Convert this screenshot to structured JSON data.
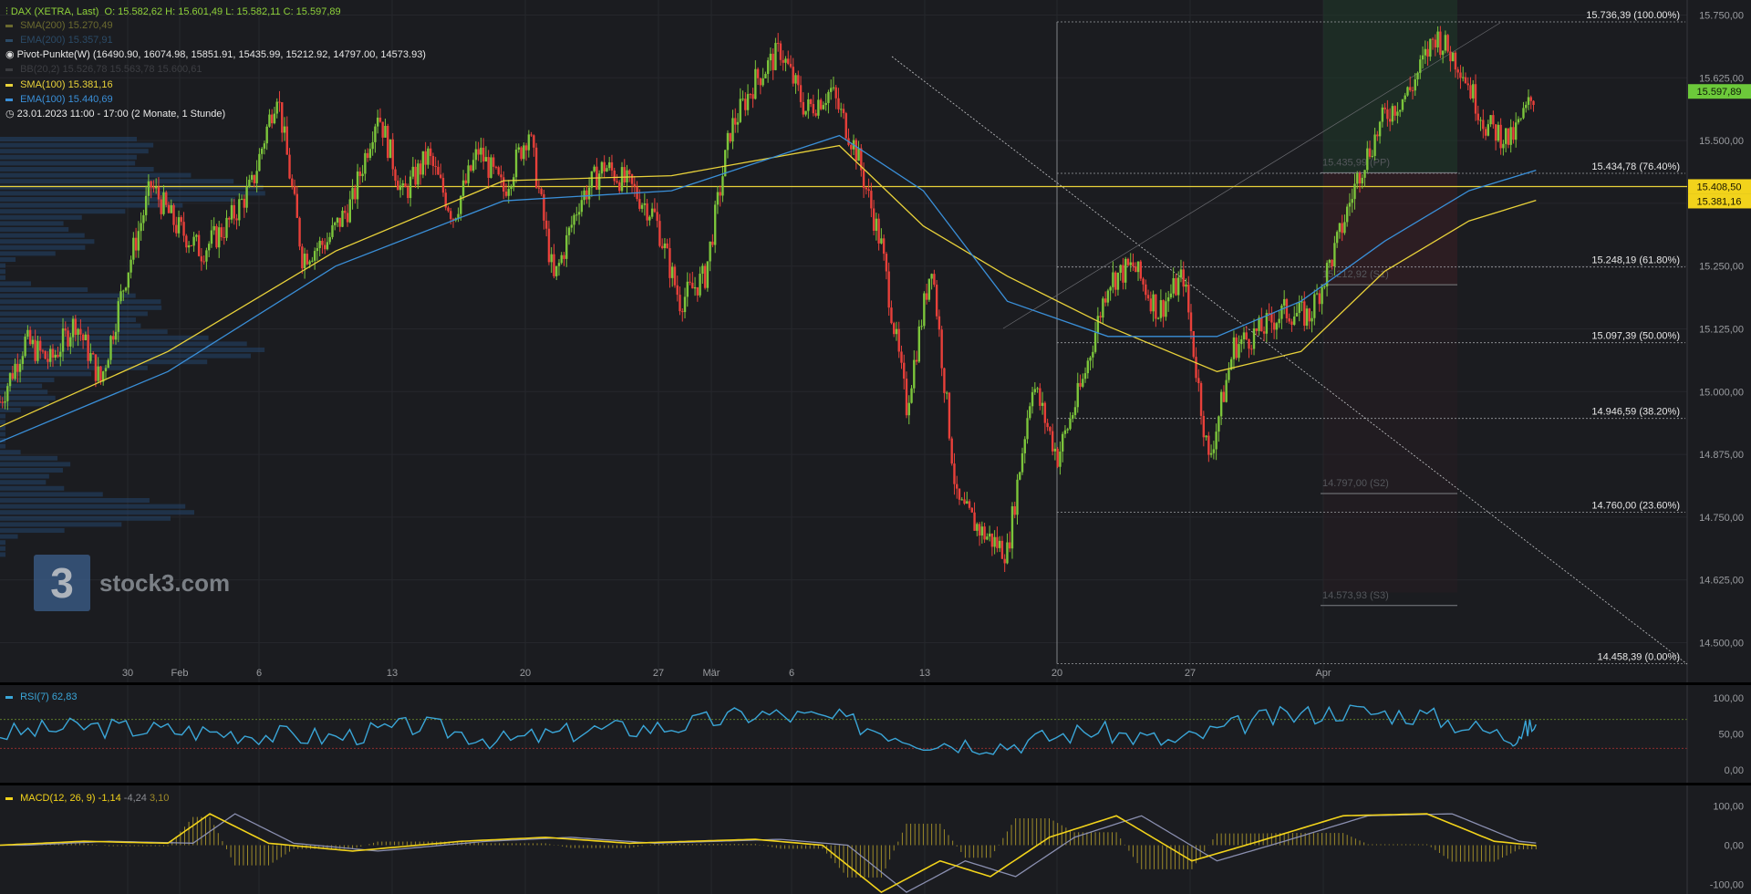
{
  "header": {
    "symbol": "DAX (XETRA, Last)",
    "ohlc": "O: 15.582,62  H: 15.601,49  L: 15.582,11  C: 15.597,89",
    "sma200": {
      "label": "SMA(200)",
      "value": "15.270,49",
      "color": "#6b6a2f"
    },
    "ema200": {
      "label": "EMA(200)",
      "value": "15.357,91",
      "color": "#2b4a66"
    },
    "pivot": {
      "label": "Pivot-Punkte(W)",
      "value": "(16490.90,  16074.98,  15851.91,  15435.99,  15212.92,  14797.00,  14573.93)"
    },
    "bb": {
      "label": "BB(20,2)",
      "value": "15.526,78  15.563,78  15.600,61"
    },
    "sma100": {
      "label": "SMA(100)",
      "value": "15.381,16",
      "color": "#e9d23a"
    },
    "ema100": {
      "label": "EMA(100)",
      "value": "15.440,69",
      "color": "#3a8fd8"
    },
    "range": "23.01.2023 11:00 - 17:00   (2 Monate, 1 Stunde)"
  },
  "logo": {
    "mark": "3",
    "text": "stock3.com"
  },
  "price_axis": {
    "ticks": [
      "15.750,00",
      "15.625,00",
      "15.500,00",
      "15.375,00",
      "15.250,00",
      "15.125,00",
      "15.000,00",
      "14.875,00",
      "14.750,00",
      "14.625,00",
      "14.500,00"
    ],
    "last_price": "15.597,89",
    "level_a": "15.408,50",
    "level_b": "15.381,16"
  },
  "fib_labels": [
    "15.736,39 (100.00%)",
    "15.434,78 (76.40%)",
    "15.248,19 (61.80%)",
    "15.097,39 (50.00%)",
    "14.946,59 (38.20%)",
    "14.760,00 (23.60%)",
    "14.458,39 (0.00%)"
  ],
  "pivot_labels": [
    "15.435,99 (PP)",
    "15.212,92 (S1)",
    "14.797,00 (S2)",
    "14.573,93 (S3)"
  ],
  "date_labels": [
    "30",
    "Feb",
    "6",
    "13",
    "20",
    "27",
    "Mär",
    "6",
    "13",
    "20",
    "27",
    "Apr"
  ],
  "rsi": {
    "label": "RSI(7)",
    "value": "62,83",
    "ticks": [
      "100,00",
      "50,00",
      "0,00"
    ],
    "color": "#3aa6d8"
  },
  "macd": {
    "label": "MACD(12, 26, 9)",
    "value": "-1,14",
    "signal": "-4,24",
    "hist": "3,10",
    "ticks": [
      "100,00",
      "0,00",
      "-100,00"
    ],
    "color": "#f2d31b"
  },
  "chart_data": {
    "type": "candlestick",
    "title": "DAX (XETRA, Last)",
    "y_range": [
      14450,
      15780
    ],
    "x_range_dates": [
      "2023-01-23",
      "2023-04-12"
    ],
    "price_path": [
      [
        0,
        14980
      ],
      [
        0.03,
        15100
      ],
      [
        0.06,
        15060
      ],
      [
        0.09,
        15140
      ],
      [
        0.12,
        15020
      ],
      [
        0.15,
        15230
      ],
      [
        0.18,
        15410
      ],
      [
        0.21,
        15330
      ],
      [
        0.24,
        15280
      ],
      [
        0.27,
        15330
      ],
      [
        0.3,
        15410
      ],
      [
        0.33,
        15600
      ],
      [
        0.36,
        15270
      ],
      [
        0.39,
        15300
      ],
      [
        0.42,
        15380
      ],
      [
        0.45,
        15560
      ],
      [
        0.48,
        15390
      ],
      [
        0.51,
        15470
      ],
      [
        0.54,
        15350
      ],
      [
        0.57,
        15480
      ],
      [
        0.6,
        15400
      ],
      [
        0.63,
        15520
      ],
      [
        0.66,
        15220
      ],
      [
        0.69,
        15380
      ],
      [
        0.72,
        15450
      ],
      [
        0.75,
        15410
      ],
      [
        0.78,
        15350
      ],
      [
        0.81,
        15180
      ],
      [
        0.84,
        15230
      ],
      [
        0.87,
        15520
      ],
      [
        0.9,
        15620
      ],
      [
        0.93,
        15680
      ],
      [
        0.96,
        15560
      ],
      [
        0.99,
        15600
      ],
      [
        1.02,
        15480
      ],
      [
        1.05,
        15290
      ],
      [
        1.08,
        14970
      ],
      [
        1.11,
        15260
      ],
      [
        1.14,
        14780
      ],
      [
        1.17,
        14720
      ],
      [
        1.2,
        14680
      ],
      [
        1.23,
        15020
      ],
      [
        1.26,
        14870
      ],
      [
        1.29,
        15020
      ],
      [
        1.32,
        15220
      ],
      [
        1.35,
        15250
      ],
      [
        1.38,
        15160
      ],
      [
        1.41,
        15230
      ],
      [
        1.44,
        14860
      ],
      [
        1.47,
        15090
      ],
      [
        1.5,
        15120
      ],
      [
        1.53,
        15160
      ],
      [
        1.56,
        15150
      ],
      [
        1.59,
        15280
      ],
      [
        1.62,
        15440
      ],
      [
        1.65,
        15550
      ],
      [
        1.68,
        15600
      ],
      [
        1.71,
        15710
      ],
      [
        1.74,
        15650
      ],
      [
        1.77,
        15530
      ],
      [
        1.8,
        15500
      ],
      [
        1.83,
        15598
      ]
    ],
    "overlays": [
      {
        "name": "SMA(100)",
        "color": "#e9d23a",
        "path": [
          [
            0,
            14930
          ],
          [
            0.2,
            15080
          ],
          [
            0.4,
            15280
          ],
          [
            0.6,
            15420
          ],
          [
            0.8,
            15430
          ],
          [
            1.0,
            15490
          ],
          [
            1.1,
            15330
          ],
          [
            1.2,
            15230
          ],
          [
            1.32,
            15130
          ],
          [
            1.45,
            15040
          ],
          [
            1.55,
            15080
          ],
          [
            1.65,
            15240
          ],
          [
            1.75,
            15340
          ],
          [
            1.83,
            15381
          ]
        ]
      },
      {
        "name": "EMA(100)",
        "color": "#3a8fd8",
        "path": [
          [
            0,
            14900
          ],
          [
            0.2,
            15040
          ],
          [
            0.4,
            15250
          ],
          [
            0.6,
            15380
          ],
          [
            0.8,
            15400
          ],
          [
            1.0,
            15510
          ],
          [
            1.1,
            15400
          ],
          [
            1.2,
            15180
          ],
          [
            1.32,
            15110
          ],
          [
            1.45,
            15110
          ],
          [
            1.55,
            15180
          ],
          [
            1.65,
            15300
          ],
          [
            1.75,
            15400
          ],
          [
            1.83,
            15441
          ]
        ]
      }
    ],
    "horizontal_levels": [
      {
        "label": "Pivot PP",
        "value": 15408.5,
        "color": "#e9d23a"
      }
    ],
    "fibonacci": [
      {
        "pct": "100.00%",
        "value": 15736.39
      },
      {
        "pct": "76.40%",
        "value": 15434.78
      },
      {
        "pct": "61.80%",
        "value": 15248.19
      },
      {
        "pct": "50.00%",
        "value": 15097.39
      },
      {
        "pct": "38.20%",
        "value": 14946.59
      },
      {
        "pct": "23.60%",
        "value": 14760.0
      },
      {
        "pct": "0.00%",
        "value": 14458.39
      }
    ],
    "pivot_points": [
      {
        "label": "PP",
        "value": 15435.99
      },
      {
        "label": "S1",
        "value": 15212.92
      },
      {
        "label": "S2",
        "value": 14797.0
      },
      {
        "label": "S3",
        "value": 14573.93
      }
    ],
    "rsi_path": [
      [
        0,
        50
      ],
      [
        0.1,
        60
      ],
      [
        0.2,
        55
      ],
      [
        0.3,
        50
      ],
      [
        0.4,
        45
      ],
      [
        0.5,
        62
      ],
      [
        0.6,
        40
      ],
      [
        0.7,
        55
      ],
      [
        0.8,
        60
      ],
      [
        0.9,
        78
      ],
      [
        1.0,
        70
      ],
      [
        1.1,
        40
      ],
      [
        1.2,
        35
      ],
      [
        1.3,
        55
      ],
      [
        1.4,
        38
      ],
      [
        1.5,
        70
      ],
      [
        1.6,
        82
      ],
      [
        1.7,
        75
      ],
      [
        1.8,
        45
      ],
      [
        1.83,
        63
      ]
    ],
    "macd_path": [
      [
        0,
        0
      ],
      [
        0.1,
        10
      ],
      [
        0.2,
        5
      ],
      [
        0.25,
        80
      ],
      [
        0.32,
        5
      ],
      [
        0.42,
        -15
      ],
      [
        0.55,
        10
      ],
      [
        0.65,
        20
      ],
      [
        0.75,
        5
      ],
      [
        0.9,
        15
      ],
      [
        0.98,
        0
      ],
      [
        1.05,
        -120
      ],
      [
        1.12,
        -40
      ],
      [
        1.18,
        -80
      ],
      [
        1.25,
        20
      ],
      [
        1.33,
        75
      ],
      [
        1.42,
        -40
      ],
      [
        1.5,
        10
      ],
      [
        1.6,
        75
      ],
      [
        1.7,
        80
      ],
      [
        1.78,
        10
      ],
      [
        1.83,
        -1
      ]
    ],
    "grid": true
  }
}
